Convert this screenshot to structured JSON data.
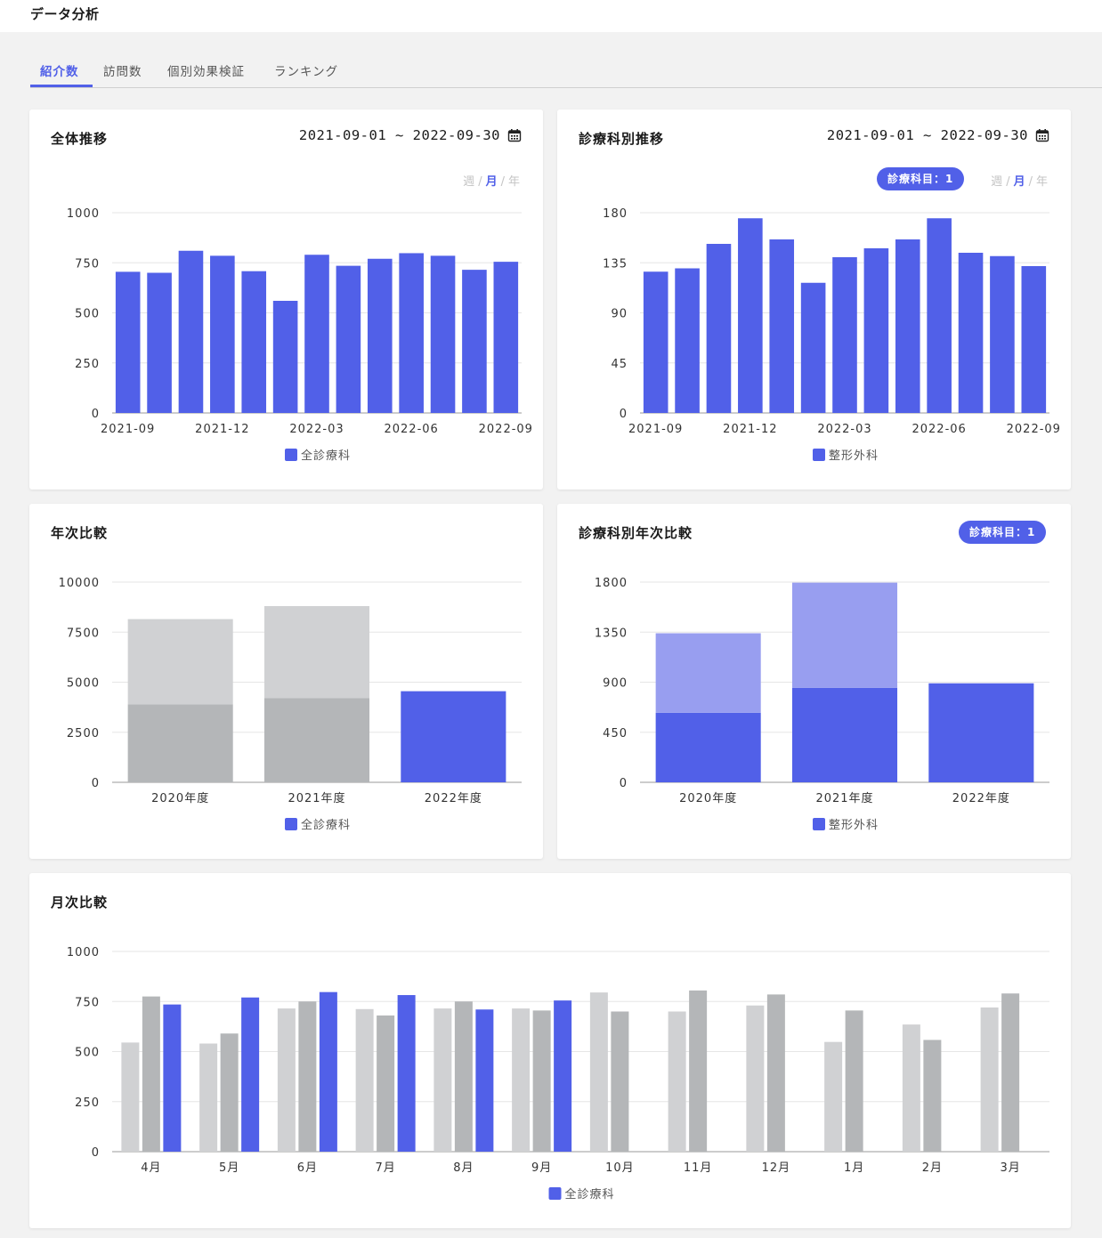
{
  "app": {
    "title": "データ分析"
  },
  "tabs": [
    {
      "label": "紹介数",
      "active": true
    },
    {
      "label": "訪問数",
      "active": false
    },
    {
      "label": "個別効果検証",
      "active": false
    },
    {
      "label": "ランキング",
      "active": false
    }
  ],
  "colors": {
    "accent": "#5160e8",
    "accent_light": "#989ef0",
    "gray_light": "#d0d1d3",
    "gray_dark": "#b4b6b8",
    "grid": "#e6e6e6",
    "axis": "#999999"
  },
  "period_labels": {
    "week": "週",
    "month": "月",
    "year": "年",
    "active": "month"
  },
  "cards": {
    "overall": {
      "title": "全体推移",
      "date_range": "2021-09-01 ~ 2022-09-30",
      "calendar_icon": "calendar-icon"
    },
    "dept": {
      "title": "診療科別推移",
      "date_range": "2021-09-01 ~ 2022-09-30",
      "calendar_icon": "calendar-icon",
      "badge": "診療科目：1"
    },
    "yearly": {
      "title": "年次比較"
    },
    "dept_yearly": {
      "title": "診療科別年次比較",
      "badge": "診療科目：1"
    },
    "monthly": {
      "title": "月次比較"
    }
  },
  "chart_data": [
    {
      "id": "overall",
      "type": "bar",
      "categories": [
        "2021-09",
        "2021-10",
        "2021-11",
        "2021-12",
        "2022-01",
        "2022-02",
        "2022-03",
        "2022-04",
        "2022-05",
        "2022-06",
        "2022-07",
        "2022-08",
        "2022-09"
      ],
      "tick_labels": [
        "2021-09",
        "2021-12",
        "2022-03",
        "2022-06",
        "2022-09"
      ],
      "tick_label_indices": [
        0,
        3,
        6,
        9,
        12
      ],
      "series": [
        {
          "name": "全診療科",
          "values": [
            705,
            700,
            810,
            785,
            708,
            560,
            790,
            735,
            770,
            798,
            785,
            715,
            755
          ],
          "color": "#5160e8"
        }
      ],
      "yticks": [
        0,
        250,
        500,
        750,
        1000
      ],
      "ylim": [
        0,
        1000
      ],
      "legend": "bottom"
    },
    {
      "id": "dept",
      "type": "bar",
      "categories": [
        "2021-09",
        "2021-10",
        "2021-11",
        "2021-12",
        "2022-01",
        "2022-02",
        "2022-03",
        "2022-04",
        "2022-05",
        "2022-06",
        "2022-07",
        "2022-08",
        "2022-09"
      ],
      "tick_labels": [
        "2021-09",
        "2021-12",
        "2022-03",
        "2022-06",
        "2022-09"
      ],
      "tick_label_indices": [
        0,
        3,
        6,
        9,
        12
      ],
      "series": [
        {
          "name": "整形外科",
          "values": [
            127,
            130,
            152,
            175,
            156,
            117,
            140,
            148,
            156,
            175,
            144,
            141,
            132
          ],
          "color": "#5160e8"
        }
      ],
      "yticks": [
        0,
        45,
        90,
        135,
        180
      ],
      "ylim": [
        0,
        180
      ],
      "legend": "bottom"
    },
    {
      "id": "yearly",
      "type": "bar",
      "stacked": true,
      "categories": [
        "2020年度",
        "2021年度",
        "2022年度"
      ],
      "stacks": [
        {
          "lower": 3900,
          "upper": 4250,
          "colors": [
            "#b4b6b8",
            "#d0d1d3"
          ]
        },
        {
          "lower": 4200,
          "upper": 4600,
          "colors": [
            "#b4b6b8",
            "#d0d1d3"
          ]
        },
        {
          "lower": 4550,
          "upper": 0,
          "colors": [
            "#5160e8",
            "#5160e8"
          ]
        }
      ],
      "legend_label": "全診療科",
      "yticks": [
        0,
        2500,
        5000,
        7500,
        10000
      ],
      "ylim": [
        0,
        10000
      ],
      "legend": "bottom"
    },
    {
      "id": "dept_yearly",
      "type": "bar",
      "stacked": true,
      "categories": [
        "2020年度",
        "2021年度",
        "2022年度"
      ],
      "stacks": [
        {
          "lower": 625,
          "upper": 715,
          "colors": [
            "#5160e8",
            "#989ef0"
          ]
        },
        {
          "lower": 850,
          "upper": 945,
          "colors": [
            "#5160e8",
            "#989ef0"
          ]
        },
        {
          "lower": 890,
          "upper": 0,
          "colors": [
            "#5160e8",
            "#989ef0"
          ]
        }
      ],
      "legend_label": "整形外科",
      "yticks": [
        0,
        450,
        900,
        1350,
        1800
      ],
      "ylim": [
        0,
        1800
      ],
      "legend": "bottom"
    },
    {
      "id": "monthly",
      "type": "bar",
      "categories": [
        "4月",
        "5月",
        "6月",
        "7月",
        "8月",
        "9月",
        "10月",
        "11月",
        "12月",
        "1月",
        "2月",
        "3月"
      ],
      "series": [
        {
          "values": [
            545,
            540,
            715,
            712,
            715,
            715,
            795,
            700,
            730,
            548,
            635,
            720
          ],
          "color": "#d0d1d3"
        },
        {
          "values": [
            775,
            590,
            750,
            680,
            750,
            705,
            700,
            805,
            785,
            705,
            558,
            790
          ],
          "color": "#b4b6b8"
        },
        {
          "values": [
            735,
            770,
            797,
            782,
            710,
            755,
            null,
            null,
            null,
            null,
            null,
            null
          ],
          "color": "#5160e8"
        }
      ],
      "legend_label": "全診療科",
      "yticks": [
        0,
        250,
        500,
        750,
        1000
      ],
      "ylim": [
        0,
        1000
      ],
      "legend": "bottom"
    }
  ]
}
